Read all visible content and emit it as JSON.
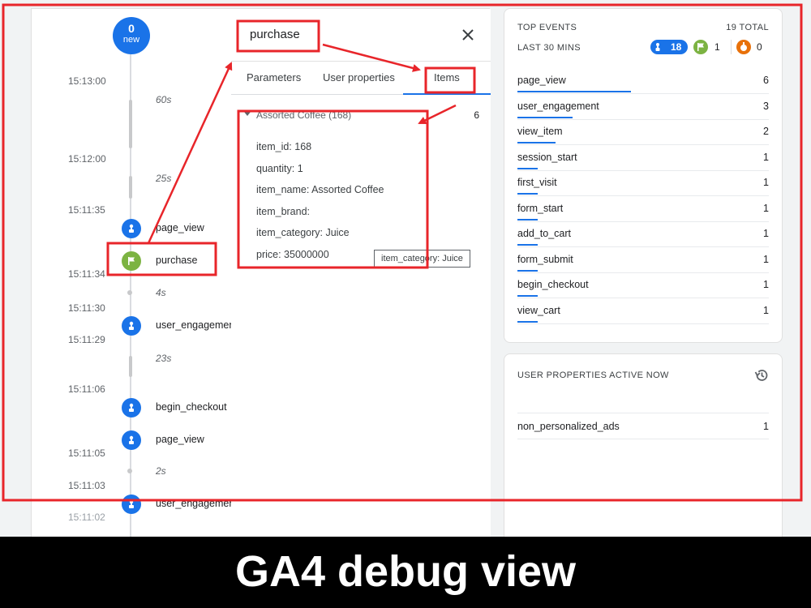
{
  "timeline": {
    "new_badge": {
      "count": "0",
      "label": "new"
    },
    "timestamps": [
      "15:13:00",
      "15:12:00",
      "15:11:35",
      "15:11:34",
      "15:11:30",
      "15:11:29",
      "15:11:06",
      "15:11:05",
      "15:11:03",
      "15:11:02"
    ],
    "gaps": [
      "60s",
      "25s",
      "4s",
      "23s",
      "2s"
    ],
    "events": [
      {
        "name": "page_view",
        "type": "blue"
      },
      {
        "name": "purchase",
        "type": "green"
      },
      {
        "name": "user_engagement",
        "type": "blue"
      },
      {
        "name": "begin_checkout",
        "type": "blue"
      },
      {
        "name": "page_view",
        "type": "blue"
      },
      {
        "name": "user_engagement",
        "type": "blue"
      }
    ]
  },
  "detail": {
    "title": "purchase",
    "tabs": [
      "Parameters",
      "User properties",
      "Items"
    ],
    "active_tab": "Items",
    "item_header": {
      "name": "Assorted Coffee (168)",
      "count": "6"
    },
    "params": [
      "item_id: 168",
      "quantity: 1",
      "item_name: Assorted Coffee",
      "item_brand:",
      "item_category: Juice",
      "price: 35000000"
    ],
    "tooltip": "item_category: Juice"
  },
  "top_events": {
    "title": "TOP EVENTS",
    "total": "19 TOTAL",
    "range": "LAST 30 MINS",
    "counts": {
      "blue": "18",
      "green": "1",
      "orange": "0"
    },
    "rows": [
      {
        "name": "page_view",
        "count": "6",
        "fraction": 0.45
      },
      {
        "name": "user_engagement",
        "count": "3",
        "fraction": 0.22
      },
      {
        "name": "view_item",
        "count": "2",
        "fraction": 0.15
      },
      {
        "name": "session_start",
        "count": "1",
        "fraction": 0.08
      },
      {
        "name": "first_visit",
        "count": "1",
        "fraction": 0.08
      },
      {
        "name": "form_start",
        "count": "1",
        "fraction": 0.08
      },
      {
        "name": "add_to_cart",
        "count": "1",
        "fraction": 0.08
      },
      {
        "name": "form_submit",
        "count": "1",
        "fraction": 0.08
      },
      {
        "name": "begin_checkout",
        "count": "1",
        "fraction": 0.08
      },
      {
        "name": "view_cart",
        "count": "1",
        "fraction": 0.08
      }
    ]
  },
  "user_properties": {
    "title": "USER PROPERTIES ACTIVE NOW",
    "rows": [
      {
        "name": "non_personalized_ads",
        "count": "1"
      }
    ]
  },
  "footer": {
    "title": "GA4 debug view"
  },
  "colors": {
    "accent": "#1a73e8",
    "green": "#7cb342",
    "orange": "#e8710a",
    "annotation": "#e8252a"
  }
}
